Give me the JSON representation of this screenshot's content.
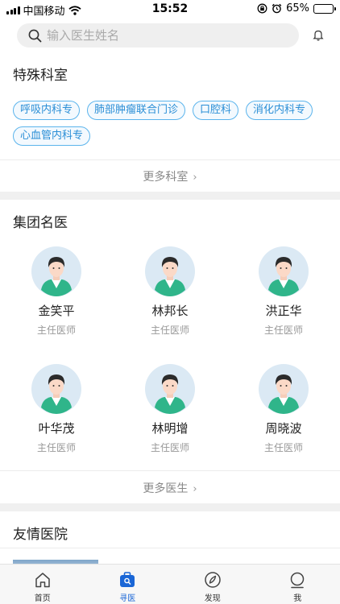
{
  "status_bar": {
    "carrier": "中国移动",
    "time": "15:52",
    "battery_text": "65%",
    "battery_level": 0.65,
    "icons": [
      "signal-icon",
      "wifi-icon",
      "rotation-lock-icon",
      "alarm-icon",
      "battery-icon"
    ]
  },
  "search": {
    "placeholder": "输入医生姓名",
    "value": ""
  },
  "special_departments": {
    "title": "特殊科室",
    "tags": [
      "呼吸内科专",
      "肺部肿瘤联合门诊",
      "口腔科",
      "消化内科专",
      "心血管内科专"
    ],
    "more_label": "更多科室"
  },
  "group_doctors": {
    "title": "集团名医",
    "doctors": [
      {
        "name": "金笑平",
        "title": "主任医师"
      },
      {
        "name": "林邦长",
        "title": "主任医师"
      },
      {
        "name": "洪正华",
        "title": "主任医师"
      },
      {
        "name": "叶华茂",
        "title": "主任医师"
      },
      {
        "name": "林明增",
        "title": "主任医师"
      },
      {
        "name": "周晓波",
        "title": "主任医师"
      }
    ],
    "more_label": "更多医生"
  },
  "friendly_hospitals": {
    "title": "友情医院"
  },
  "tab_bar": {
    "active": "寻医",
    "items": [
      {
        "label": "首页",
        "icon": "home-icon"
      },
      {
        "label": "寻医",
        "icon": "find-doctor-icon"
      },
      {
        "label": "发现",
        "icon": "discover-icon"
      },
      {
        "label": "我",
        "icon": "profile-icon"
      }
    ]
  },
  "colors": {
    "accent": "#1a66d6",
    "tag_border": "#5bb4ec",
    "tag_text": "#2a8ed6",
    "avatar_bg": "#dbe9f4",
    "scrub_green": "#2fb58a"
  }
}
